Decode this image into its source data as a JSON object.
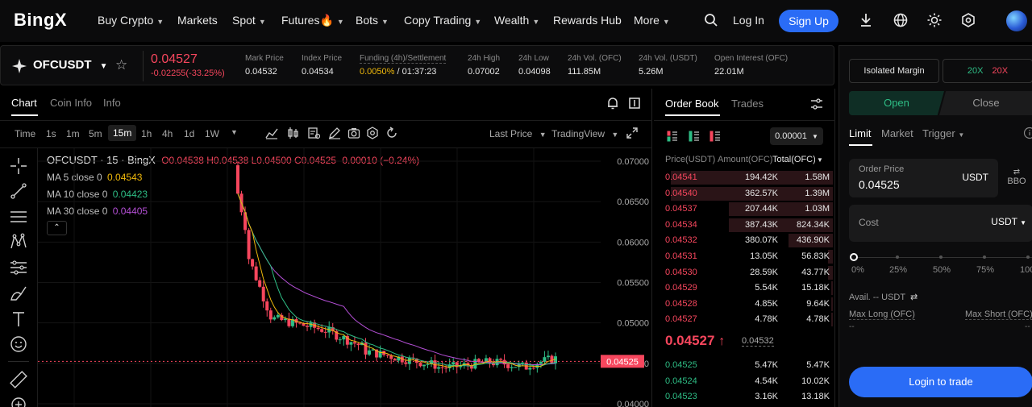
{
  "nav": {
    "logo": "BingX",
    "items": [
      {
        "label": "Buy Crypto",
        "caret": true
      },
      {
        "label": "Markets",
        "caret": false
      },
      {
        "label": "Spot",
        "caret": true
      },
      {
        "label": "Futures🔥",
        "caret": true
      },
      {
        "label": "Bots",
        "caret": true
      },
      {
        "label": "Copy Trading",
        "caret": true
      },
      {
        "label": "Wealth",
        "caret": true
      },
      {
        "label": "Rewards Hub",
        "caret": false
      },
      {
        "label": "More",
        "caret": true
      }
    ],
    "login": "Log In",
    "signup": "Sign Up"
  },
  "ticker": {
    "symbol": "OFCUSDT",
    "price": "0.04527",
    "change": "-0.02255(-33.25%)",
    "stats": [
      {
        "label": "Mark Price",
        "value": "0.04532"
      },
      {
        "label": "Index Price",
        "value": "0.04534"
      },
      {
        "label": "Funding (4h)/Settlement",
        "value_accent": "0.0050%",
        "value": " / 01:37:23"
      },
      {
        "label": "24h High",
        "value": "0.07002"
      },
      {
        "label": "24h Low",
        "value": "0.04098"
      },
      {
        "label": "24h Vol. (OFC)",
        "value": "111.85M"
      },
      {
        "label": "24h Vol. (USDT)",
        "value": "5.26M"
      },
      {
        "label": "Open Interest (OFC)",
        "value": "22.01M"
      }
    ]
  },
  "chart_tabs": [
    "Chart",
    "Coin Info",
    "Info"
  ],
  "timeframes": [
    "Time",
    "1s",
    "1m",
    "5m",
    "15m",
    "1h",
    "4h",
    "1d",
    "1W"
  ],
  "active_timeframe": "15m",
  "chart_toolbar": {
    "last_price": "Last Price",
    "view": "TradingView"
  },
  "legend": {
    "title": "OFCUSDT · 15 · BingX",
    "ohlc": "O0.04538 H0.04538 L0.04500 C0.04525 -0.00010 (−0.24%)",
    "ma5_label": "MA 5 close 0",
    "ma5_value": "0.04543",
    "ma10_label": "MA 10 close 0",
    "ma10_value": "0.04423",
    "ma30_label": "MA 30 close 0",
    "ma30_value": "0.04405"
  },
  "chart_data": {
    "type": "candlestick",
    "yaxis_ticks": [
      "0.07000",
      "0.06500",
      "0.06000",
      "0.05500",
      "0.05000",
      "0.04500",
      "0.04000"
    ],
    "ylim": [
      0.0396,
      0.0716
    ],
    "last_price_label": "0.04525",
    "colors": {
      "up": "#2ebd85",
      "down": "#f6465d",
      "ma5": "#f0b90b",
      "ma10": "#2ebd85",
      "ma30": "#b44fd6"
    }
  },
  "orderbook": {
    "tabs": [
      "Order Book",
      "Trades"
    ],
    "tick": "0.00001",
    "headers": [
      "Price(USDT)",
      "Amount(OFC)",
      "Total(OFC)"
    ],
    "asks": [
      {
        "price": "0.04541",
        "amount": "194.42K",
        "total": "1.58M",
        "depth": 0.95
      },
      {
        "price": "0.04540",
        "amount": "362.57K",
        "total": "1.39M",
        "depth": 0.95
      },
      {
        "price": "0.04537",
        "amount": "207.44K",
        "total": "1.03M",
        "depth": 0.61
      },
      {
        "price": "0.04534",
        "amount": "387.43K",
        "total": "824.34K",
        "depth": 0.61
      },
      {
        "price": "0.04532",
        "amount": "380.07K",
        "total": "436.90K",
        "depth": 0.26
      },
      {
        "price": "0.04531",
        "amount": "13.05K",
        "total": "56.83K",
        "depth": 0.03
      },
      {
        "price": "0.04530",
        "amount": "28.59K",
        "total": "43.77K",
        "depth": 0.03
      },
      {
        "price": "0.04529",
        "amount": "5.54K",
        "total": "15.18K",
        "depth": 0.01
      },
      {
        "price": "0.04528",
        "amount": "4.85K",
        "total": "9.64K",
        "depth": 0.01
      },
      {
        "price": "0.04527",
        "amount": "4.78K",
        "total": "4.78K",
        "depth": 0.01
      }
    ],
    "mid_price": "0.04527",
    "mid_mark": "0.04532",
    "bids": [
      {
        "price": "0.04525",
        "amount": "5.47K",
        "total": "5.47K"
      },
      {
        "price": "0.04524",
        "amount": "4.54K",
        "total": "10.02K"
      },
      {
        "price": "0.04523",
        "amount": "3.16K",
        "total": "13.18K"
      }
    ]
  },
  "trade": {
    "margin_mode": "Isolated Margin",
    "leverage_long": "20X",
    "leverage_short": "20X",
    "open": "Open",
    "close": "Close",
    "order_types": [
      "Limit",
      "Market",
      "Trigger"
    ],
    "order_price_label": "Order Price",
    "order_price": "0.04525",
    "unit": "USDT",
    "bbo": "BBO",
    "cost_label": "Cost",
    "cost_unit": "USDT",
    "slider_marks": [
      "0%",
      "25%",
      "50%",
      "75%",
      "100%"
    ],
    "avail": "Avail. -- USDT",
    "max_long": "Max Long (OFC)",
    "max_short": "Max Short (OFC)",
    "dash": "--",
    "login_button": "Login to trade"
  }
}
